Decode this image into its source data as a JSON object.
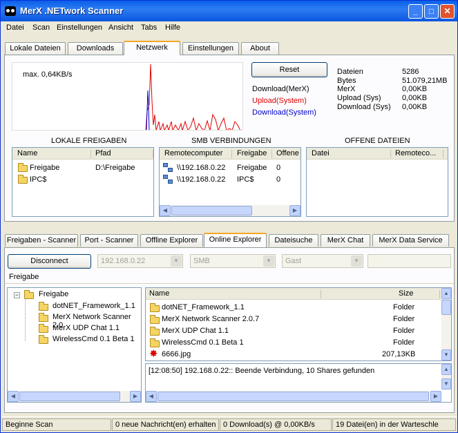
{
  "window": {
    "title": "MerX .NETwork Scanner"
  },
  "menu": [
    "Datei",
    "Scan",
    "Einstellungen",
    "Ansicht",
    "Tabs",
    "Hilfe"
  ],
  "top_tabs": [
    "Lokale Dateien",
    "Downloads",
    "Netzwerk",
    "Einstellungen",
    "About"
  ],
  "graph": {
    "max_label": "max. 0,64KB/s"
  },
  "reset_label": "Reset",
  "legend": {
    "download_merx": "Download(MerX)",
    "upload_system": "Upload(System)",
    "download_system": "Download(System)"
  },
  "legend_colors": {
    "download_merx": "#000000",
    "upload_system": "#e00000",
    "download_system": "#0000c8"
  },
  "stats": [
    {
      "label": "Dateien",
      "value": "5286"
    },
    {
      "label": "Bytes",
      "value": "51.079,21MB"
    },
    {
      "label": "MerX",
      "value": "0,00KB"
    },
    {
      "label": "Upload (Sys)",
      "value": "0,00KB"
    },
    {
      "label": "Download (Sys)",
      "value": "0,00KB"
    }
  ],
  "local_shares": {
    "title": "LOKALE FREIGABEN",
    "columns": [
      "Name",
      "Pfad"
    ],
    "rows": [
      {
        "name": "Freigabe",
        "path": "D:\\Freigabe"
      },
      {
        "name": "IPC$",
        "path": ""
      }
    ]
  },
  "smb": {
    "title": "SMB VERBINDUNGEN",
    "columns": [
      "Remotecomputer",
      "Freigabe",
      "Offene"
    ],
    "rows": [
      {
        "remote": "\\\\192.168.0.22",
        "share": "Freigabe",
        "open": "0"
      },
      {
        "remote": "\\\\192.168.0.22",
        "share": "IPC$",
        "open": "0"
      }
    ]
  },
  "open_files": {
    "title": "OFFENE DATEIEN",
    "columns": [
      "Datei",
      "Remoteco..."
    ]
  },
  "bottom_tabs": [
    "Freigaben - Scanner",
    "Port - Scanner",
    "Offline Explorer",
    "Online Explorer",
    "Dateisuche",
    "MerX Chat",
    "MerX Data Service"
  ],
  "explorer": {
    "disconnect_label": "Disconnect",
    "ip_value": "192.168.0.22",
    "protocol_value": "SMB",
    "user_value": "Gast",
    "path_value": "Freigabe",
    "tree": {
      "root": "Freigabe",
      "children": [
        "dotNET_Framework_1.1",
        "MerX Network Scanner 2.0",
        "MerX UDP Chat 1.1",
        "WirelessCmd 0.1 Beta 1"
      ]
    },
    "files": {
      "columns": [
        "Name",
        "Size"
      ],
      "rows": [
        {
          "name": "dotNET_Framework_1.1",
          "size": "Folder"
        },
        {
          "name": "MerX Network Scanner 2.0.7",
          "size": "Folder"
        },
        {
          "name": "MerX UDP Chat 1.1",
          "size": "Folder"
        },
        {
          "name": "WirelessCmd 0.1 Beta 1",
          "size": "Folder"
        },
        {
          "name": "6666.jpg",
          "size": "207,13KB"
        }
      ]
    },
    "log": "[12:08:50] 192.168.0.22:: Beende Verbindung, 10 Shares gefunden"
  },
  "status": [
    "Beginne Scan",
    "0 neue Nachricht(en) erhalten",
    "0 Download(s) @ 0,00KB/s",
    "19 Datei(en) in der Warteschle"
  ]
}
